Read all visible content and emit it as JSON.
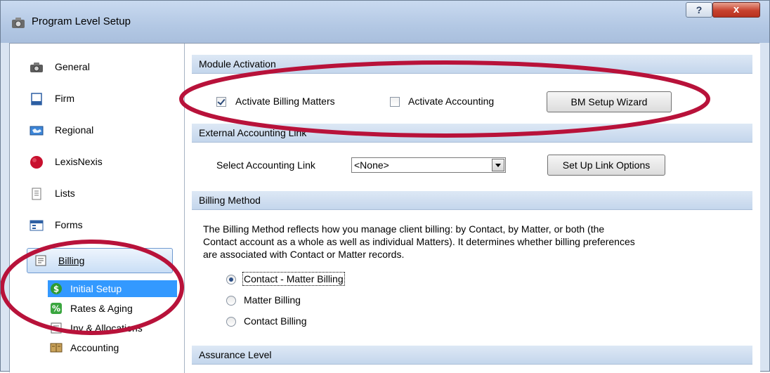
{
  "window": {
    "title": "Program Level Setup",
    "help_label": "?",
    "close_label": "x"
  },
  "sidebar": {
    "items": [
      {
        "label": "General",
        "icon": "camera-icon"
      },
      {
        "label": "Firm",
        "icon": "document-icon"
      },
      {
        "label": "Regional",
        "icon": "regional-map-icon"
      },
      {
        "label": "LexisNexis",
        "icon": "lexisnexis-logo-icon"
      },
      {
        "label": "Lists",
        "icon": "list-icon"
      },
      {
        "label": "Forms",
        "icon": "form-icon"
      },
      {
        "label": "Billing",
        "icon": "billing-icon"
      }
    ],
    "billing_subitems": [
      {
        "label": "Initial Setup",
        "icon": "dollar-icon"
      },
      {
        "label": "Rates & Aging",
        "icon": "percent-icon"
      },
      {
        "label": "Inv & Allocations",
        "icon": "invoice-icon"
      },
      {
        "label": "Accounting",
        "icon": "ledger-book-icon"
      }
    ]
  },
  "module_activation": {
    "header": "Module Activation",
    "activate_billing_label": "Activate Billing Matters",
    "activate_billing_checked": true,
    "activate_accounting_label": "Activate Accounting",
    "activate_accounting_checked": false,
    "wizard_button": "BM Setup Wizard"
  },
  "external_link": {
    "header": "External Accounting Link",
    "select_label": "Select Accounting Link",
    "select_value": "<None>",
    "options_button": "Set Up Link Options"
  },
  "billing_method": {
    "header": "Billing Method",
    "description_lines": [
      "The Billing Method reflects how you manage client billing: by Contact, by Matter, or both (the",
      "Contact account as a whole as well as individual Matters).  It determines whether billing preferences",
      "are associated with Contact or Matter records."
    ],
    "options": [
      {
        "label": "Contact - Matter Billing",
        "selected": true
      },
      {
        "label": "Matter Billing",
        "selected": false
      },
      {
        "label": "Contact Billing",
        "selected": false
      }
    ]
  },
  "assurance_level": {
    "header": "Assurance Level"
  },
  "colors": {
    "highlight_ellipse": "#b8123a",
    "selection_blue": "#3399ff"
  }
}
